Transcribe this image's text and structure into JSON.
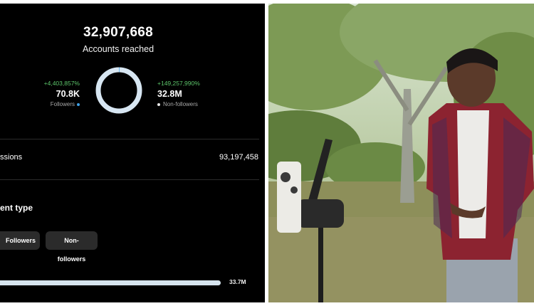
{
  "insights": {
    "accounts_reached": "32,907,668",
    "accounts_reached_label": "Accounts reached",
    "followers": {
      "growth": "+4,403,857%",
      "value": "70.8K",
      "label": "Followers"
    },
    "non_followers": {
      "growth": "+149,257,990%",
      "value": "32.8M",
      "label": "Non-followers"
    },
    "donut_follower_share": 0.002,
    "impressions_label": "ssions",
    "impressions_value": "93,197,458",
    "content_type_title": "ent type",
    "filters": [
      "Followers",
      "Non-followers"
    ],
    "bar_value": "33.7M",
    "bar_fill_fraction": 1.0
  },
  "colors": {
    "followers": "#3ea0e6",
    "non_followers": "#e8e8e8",
    "growth": "#5cc46a",
    "panel_bg": "#000000"
  },
  "photo": {
    "description_icon": "man-with-phone-on-tripod"
  }
}
